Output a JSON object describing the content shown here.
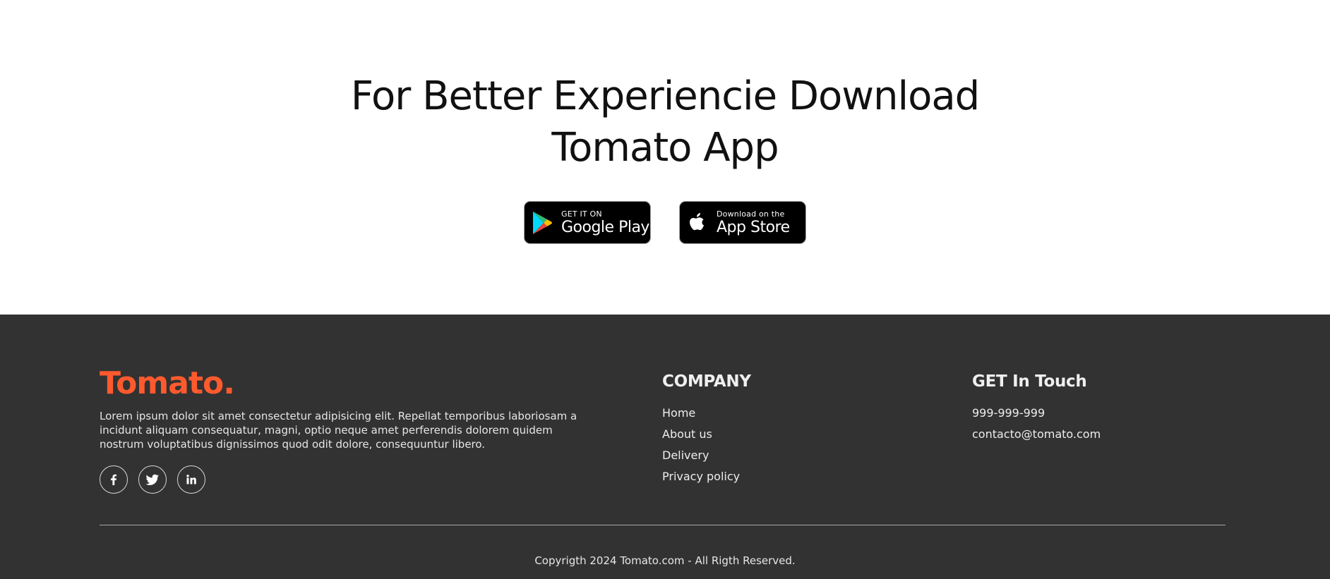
{
  "app_download": {
    "title_line1": "For Better Experiencie Download",
    "title_line2": "Tomato App",
    "google_play": {
      "small": "GET IT ON",
      "big": "Google Play",
      "icon": "google-play-icon"
    },
    "app_store": {
      "small": "Download on the",
      "big": "App Store",
      "icon": "apple-icon"
    }
  },
  "footer": {
    "logo": "Tomato.",
    "description": "Lorem ipsum dolor sit amet consectetur adipisicing elit. Repellat temporibus laboriosam a incidunt aliquam consequatur, magni, optio neque amet perferendis dolorem quidem nostrum voluptatibus dignissimos quod odit dolore, consequuntur libero.",
    "socials": [
      {
        "name": "facebook",
        "icon": "facebook-icon"
      },
      {
        "name": "twitter",
        "icon": "twitter-icon"
      },
      {
        "name": "linkedin",
        "icon": "linkedin-icon"
      }
    ],
    "company": {
      "title": "COMPANY",
      "links": [
        "Home",
        "About us",
        "Delivery",
        "Privacy policy"
      ]
    },
    "contact": {
      "title": "GET In Touch",
      "phone": "999-999-999",
      "email": "contacto@tomato.com"
    },
    "copyright": "Copyrigth 2024 Tomato.com - All Rigth Reserved."
  },
  "colors": {
    "footer_bg": "#323232",
    "logo": "#ff5a2e",
    "page_bg": "#ffffff"
  }
}
